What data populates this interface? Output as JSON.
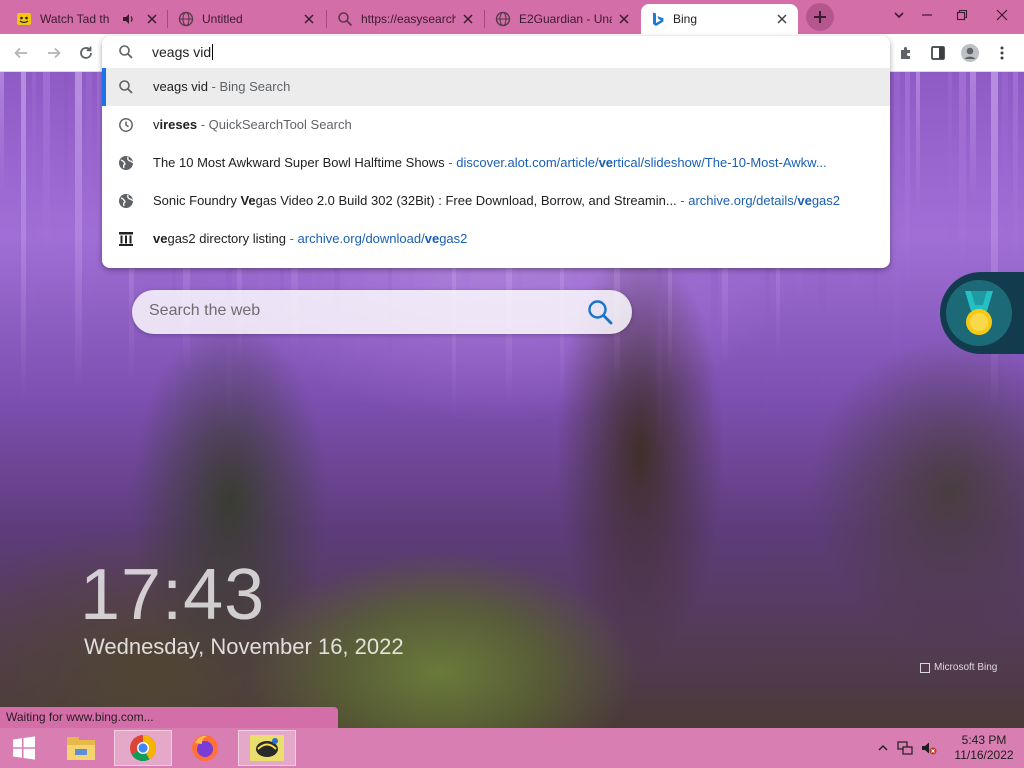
{
  "tabs": [
    {
      "label": "Watch Tad th",
      "icon": "smiley-favicon-icon",
      "active": false
    },
    {
      "label": "Untitled",
      "icon": "globe-icon",
      "active": false
    },
    {
      "label": "https://easysearch",
      "icon": "search-icon",
      "active": false
    },
    {
      "label": "E2Guardian - Una",
      "icon": "globe-icon",
      "active": false
    },
    {
      "label": "Bing",
      "icon": "bing-icon",
      "active": true
    }
  ],
  "omnibox": {
    "typed": "veags vid",
    "suggestions": [
      {
        "icon": "search-icon",
        "parts": [
          {
            "t": "veags vid",
            "s": "normal"
          },
          {
            "t": " - Bing Search",
            "s": "desc"
          }
        ]
      },
      {
        "icon": "history-icon",
        "parts": [
          {
            "t": "v",
            "s": "normal"
          },
          {
            "t": "ireses",
            "s": "bold"
          },
          {
            "t": " - QuickSearchTool Search",
            "s": "desc"
          }
        ]
      },
      {
        "icon": "globe-icon",
        "parts": [
          {
            "t": "The 10 Most Awkward Super Bowl Halftime Shows",
            "s": "normal"
          },
          {
            "t": " - ",
            "s": "desc"
          },
          {
            "t": "discover.alot.com/article/",
            "s": "url"
          },
          {
            "t": "ve",
            "s": "urlbold"
          },
          {
            "t": "rtical/slideshow/The-10-Most-Awkw...",
            "s": "url"
          }
        ]
      },
      {
        "icon": "globe-icon",
        "parts": [
          {
            "t": "Sonic Foundry ",
            "s": "normal"
          },
          {
            "t": "Ve",
            "s": "bold"
          },
          {
            "t": "gas Video 2.0 Build 302 (32Bit) : Free Download, Borrow, and Streamin...",
            "s": "normal"
          },
          {
            "t": "  - ",
            "s": "desc"
          },
          {
            "t": "archive.org/details/",
            "s": "url"
          },
          {
            "t": "ve",
            "s": "urlbold"
          },
          {
            "t": "gas2",
            "s": "url"
          }
        ]
      },
      {
        "icon": "archive-icon",
        "parts": [
          {
            "t": "ve",
            "s": "bold"
          },
          {
            "t": "gas2 directory listing",
            "s": "normal"
          },
          {
            "t": " - ",
            "s": "desc"
          },
          {
            "t": "archive.org/download/",
            "s": "url"
          },
          {
            "t": "ve",
            "s": "urlbold"
          },
          {
            "t": "gas2",
            "s": "url"
          }
        ]
      }
    ]
  },
  "page": {
    "search_placeholder": "Search the web",
    "clock": "17:43",
    "date": "Wednesday, November 16, 2022",
    "watermark": "Microsoft Bing"
  },
  "status_text": "Waiting for www.bing.com...",
  "taskbar": {
    "apps": [
      "start-icon",
      "file-explorer-icon",
      "chrome-icon",
      "firefox-icon",
      "pen-tool-icon"
    ],
    "time": "5:43 PM",
    "date": "11/16/2022"
  },
  "colors": {
    "tabstrip": "#d46ea8",
    "taskbar": "#d97eb2",
    "link": "#1a5fb4",
    "selection_accent": "#1a73e8"
  }
}
